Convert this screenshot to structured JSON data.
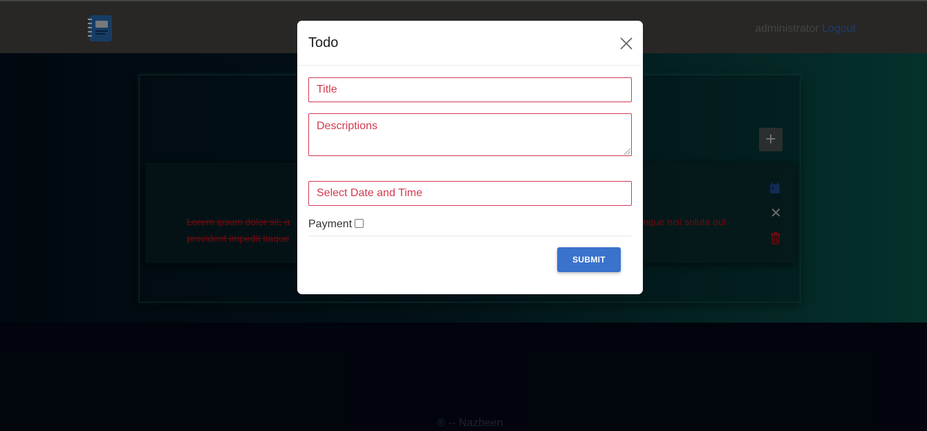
{
  "navbar": {
    "logo_icon": "notebook-icon",
    "user_name": "administrator",
    "logout_label": "Logout"
  },
  "board": {
    "add_icon": "plus-icon",
    "todo": {
      "text_line1": "Lorem ipsum dolor sit, a",
      "text_line1_end": "nque nisi soluta out",
      "text_line2": "provident impedit itaque",
      "completed": true,
      "icons": [
        "calendar-icon",
        "close-icon",
        "trash-icon"
      ]
    }
  },
  "footer": {
    "text": "® -- Nazbeen"
  },
  "modal": {
    "title": "Todo",
    "close_icon": "close-icon",
    "title_placeholder": "Title",
    "descriptions_placeholder": "Descriptions",
    "datetime_placeholder": "Select Date and Time",
    "payment_label": "Payment",
    "payment_checked": false,
    "submit_label": "SUBMIT"
  },
  "colors": {
    "accent": "#3a72cc",
    "error": "#d23a50",
    "completed_text": "#c4141e"
  }
}
